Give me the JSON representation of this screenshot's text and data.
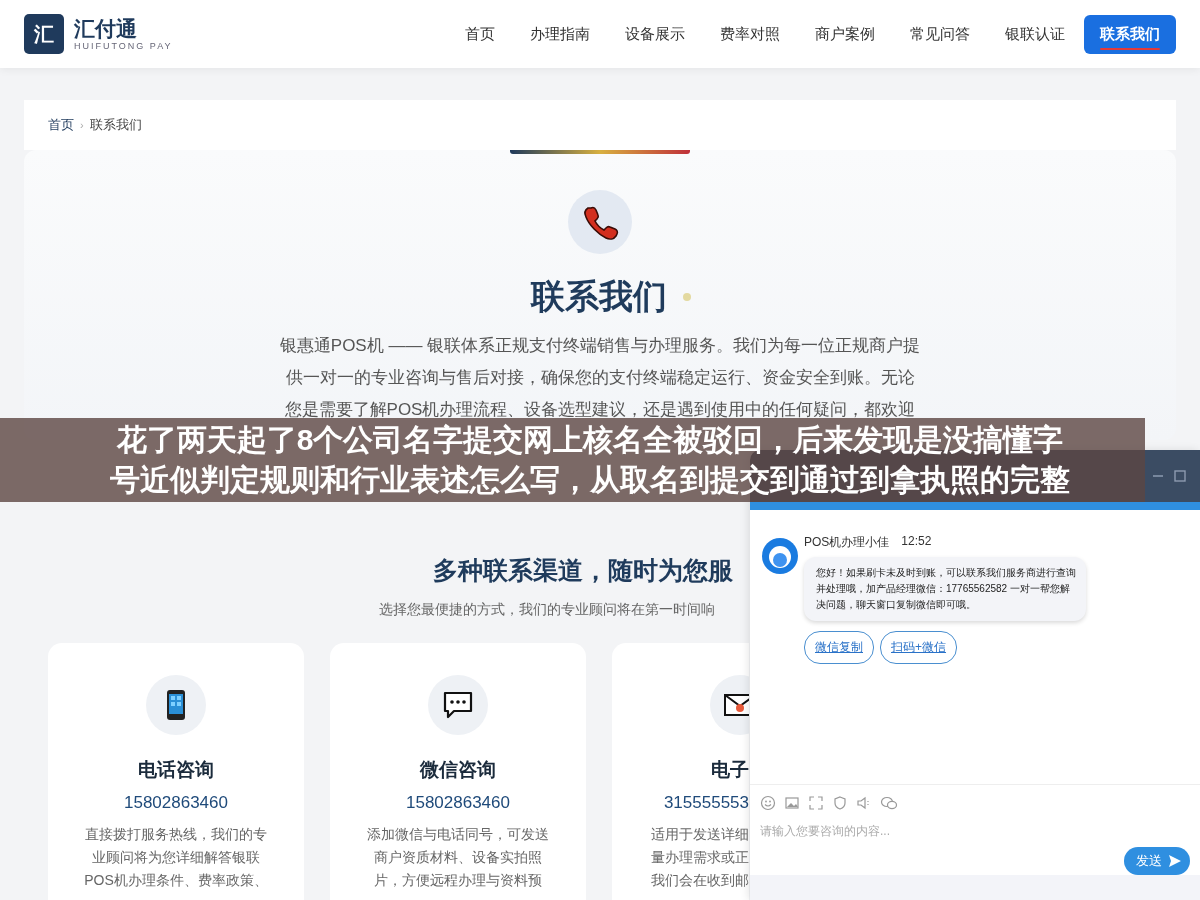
{
  "header": {
    "logo_mark": "汇",
    "brand": "汇付通",
    "brand_sub": "HUIFUTONG PAY",
    "nav": [
      {
        "label": "首页",
        "selected": false
      },
      {
        "label": "办理指南",
        "selected": false
      },
      {
        "label": "设备展示",
        "selected": false
      },
      {
        "label": "费率对照",
        "selected": false
      },
      {
        "label": "商户案例",
        "selected": false
      },
      {
        "label": "常见问答",
        "selected": false
      },
      {
        "label": "银联认证",
        "selected": false
      },
      {
        "label": "联系我们",
        "selected": true
      }
    ]
  },
  "breadcrumb": {
    "items": [
      "首页",
      "联系我们"
    ],
    "separator": "›"
  },
  "hero": {
    "title": "联系我们",
    "intro_lines": [
      "银惠通POS机 —— 银联体系正规支付终端销售与办理服务。我们为每一位正规商户提",
      "供一对一的专业咨询与售后对接，确保您的支付终端稳定运行、资金安全到账。无论",
      "您是需要了解POS机办理流程、设备选型建议，还是遇到使用中的任何疑问，都欢迎"
    ]
  },
  "channels": {
    "title": "多种联系渠道，随时为您服",
    "subtitle": "选择您最便捷的方式，我们的专业顾问将在第一时间响",
    "cards": [
      {
        "kind": "phone",
        "title": "电话咨询",
        "number": "15802863460",
        "lines": [
          "直接拨打服务热线，我们的专",
          "业顾问将为您详细解答银联",
          "POS机办理条件、费率政策、"
        ]
      },
      {
        "kind": "chat",
        "title": "微信咨询",
        "number": "15802863460",
        "lines": [
          "添加微信与电话同号，可发送",
          "商户资质材料、设备实拍照",
          "片，方便远程办理与资料预"
        ]
      },
      {
        "kind": "mail",
        "title": "电子",
        "number": "315555553",
        "lines": [
          "适用于发送详细",
          "量办理需求或正",
          "我们会在收到邮"
        ]
      }
    ]
  },
  "caption_banner": {
    "lines": [
      "花了两天起了8个公司名字提交网上核名全被驳回，后来发现是没搞懂字",
      "号近似判定规则和行业表述怎么写，从取名到提交到通过到拿执照的完整"
    ]
  },
  "chat": {
    "agent": "POS机办理小佳",
    "time": "12:52",
    "message": "您好！如果刷卡未及时到账，可以联系我们服务商进行查询并处理哦，加产品经理微信：17765562582 一对一帮您解决问题，聊天窗口复制微信即可哦。",
    "actions": [
      "微信复制",
      "扫码+微信"
    ],
    "input": {
      "placeholder": "请输入您要咨询的内容..."
    },
    "send": "发送"
  }
}
